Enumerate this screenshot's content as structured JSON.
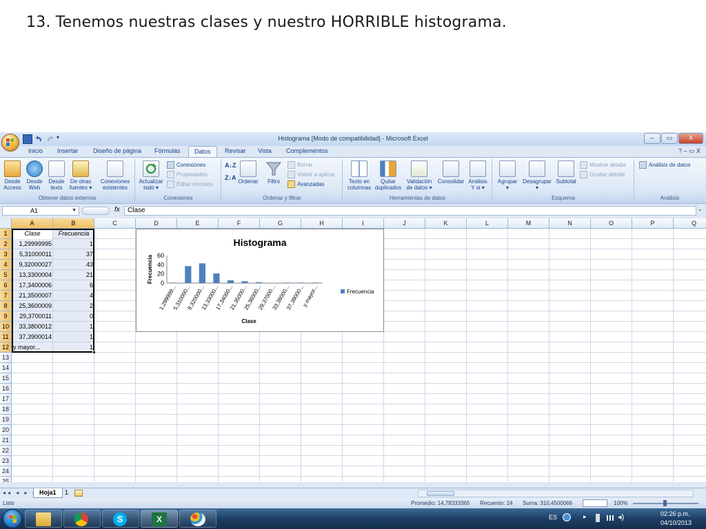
{
  "slide": {
    "title": "13. Tenemos nuestras clases y nuestro HORRIBLE histograma."
  },
  "window": {
    "title": "Histograma  [Modo de compatibilidad] - Microsoft Excel",
    "controls": [
      "–",
      "▭",
      "X"
    ]
  },
  "ribbon": {
    "tabs": [
      "Inicio",
      "Insertar",
      "Diseño de página",
      "Fórmulas",
      "Datos",
      "Revisar",
      "Vista",
      "Complementos"
    ],
    "active_tab": "Datos",
    "right_controls": "? – ▭ X",
    "groups": {
      "external": {
        "label": "Obtener datos externos",
        "buttons": [
          {
            "line1": "Desde",
            "line2": "Access"
          },
          {
            "line1": "Desde",
            "line2": "Web"
          },
          {
            "line1": "Desde",
            "line2": "texto"
          },
          {
            "line1": "De otras",
            "line2": "fuentes ▾"
          },
          {
            "line1": "Conexiones",
            "line2": "existentes"
          }
        ]
      },
      "connections": {
        "label": "Conexiones",
        "refresh": {
          "line1": "Actualizar",
          "line2": "todo ▾"
        },
        "items": [
          "Conexiones",
          "Propiedades",
          "Editar vínculos"
        ]
      },
      "sort": {
        "label": "Ordenar y filtrar",
        "sort_label": "Ordenar",
        "filter_label": "Filtro",
        "items": [
          "Borrar",
          "Volver a aplicar",
          "Avanzadas"
        ]
      },
      "tools": {
        "label": "Herramientas de datos",
        "buttons": [
          {
            "line1": "Texto en",
            "line2": "columnas"
          },
          {
            "line1": "Quitar",
            "line2": "duplicados"
          },
          {
            "line1": "Validación",
            "line2": "de datos ▾"
          },
          {
            "line1": "Consolidar",
            "line2": ""
          },
          {
            "line1": "Análisis",
            "line2": "Y si ▾"
          }
        ]
      },
      "outline": {
        "label": "Esquema",
        "buttons": [
          {
            "line1": "Agrupar",
            "line2": "▾"
          },
          {
            "line1": "Desagrupar",
            "line2": "▾"
          },
          {
            "line1": "Subtotal",
            "line2": ""
          }
        ],
        "items": [
          "Mostrar detalle",
          "Ocultar detalle"
        ]
      },
      "analysis": {
        "label": "Análisis",
        "item": "Análisis de datos"
      }
    }
  },
  "formula_bar": {
    "name_box": "A1",
    "fx": "fx",
    "value": "Clase"
  },
  "sheet": {
    "columns": [
      "A",
      "B",
      "C",
      "D",
      "E",
      "F",
      "G",
      "H",
      "I",
      "J",
      "K",
      "L",
      "M",
      "N",
      "O",
      "P",
      "Q"
    ],
    "rows": [
      "1",
      "2",
      "3",
      "4",
      "5",
      "6",
      "7",
      "8",
      "9",
      "10",
      "11",
      "12",
      "13",
      "14",
      "15",
      "16",
      "17",
      "18",
      "19",
      "20",
      "21",
      "22",
      "23",
      "24",
      "25"
    ],
    "header_row": {
      "a": "Clase",
      "b": "Frecuencia"
    },
    "data": [
      {
        "a": "1,29999995",
        "b": "1"
      },
      {
        "a": "5,31000011",
        "b": "37"
      },
      {
        "a": "9,32000027",
        "b": "43"
      },
      {
        "a": "13,3300004",
        "b": "21"
      },
      {
        "a": "17,3400006",
        "b": "6"
      },
      {
        "a": "21,3500007",
        "b": "4"
      },
      {
        "a": "25,3600009",
        "b": "2"
      },
      {
        "a": "29,3700011",
        "b": "0"
      },
      {
        "a": "33,3800012",
        "b": "1"
      },
      {
        "a": "37,3900014",
        "b": "1"
      },
      {
        "a": "y mayor...",
        "b": "1"
      }
    ]
  },
  "chart_data": {
    "type": "bar",
    "title": "Histograma",
    "xlabel": "Clase",
    "ylabel": "Frecuencia",
    "categories": [
      "1,299999...",
      "5,310000...",
      "9,320000...",
      "13,33000...",
      "17,34000...",
      "21,35000...",
      "25,36000...",
      "29,37000...",
      "33,38000...",
      "37,39000...",
      "y mayor..."
    ],
    "series": [
      {
        "name": "Frecuencia",
        "values": [
          1,
          37,
          43,
          21,
          6,
          4,
          2,
          0,
          1,
          1,
          1
        ],
        "color": "#4f81bd"
      }
    ],
    "ylim": [
      0,
      60
    ],
    "yticks": [
      0,
      20,
      40,
      60
    ],
    "legend_position": "right",
    "grid": false
  },
  "sheet_tabs": {
    "nav": "◂◂ ◂ ▸ ▸▸",
    "tabs": [
      "Hoja1",
      "1"
    ],
    "active": "Hoja1"
  },
  "status": {
    "ready": "Listo",
    "average": "Promedio: 14,78333365",
    "count": "Recuento: 24",
    "sum": "Suma: 310,4500066",
    "zoom": "100%"
  },
  "taskbar": {
    "apps": [
      "file-explorer-icon",
      "chrome-icon",
      "skype-icon",
      "excel-icon",
      "paint-icon"
    ],
    "lang": "ES",
    "time": "02:26 p.m.",
    "date": "04/10/2013"
  },
  "colors": {
    "bar": "#4f81bd",
    "ribbon_bg": "#dfe8f5",
    "selection_header": "#f1c15f",
    "taskbar": "#1d3f66"
  }
}
